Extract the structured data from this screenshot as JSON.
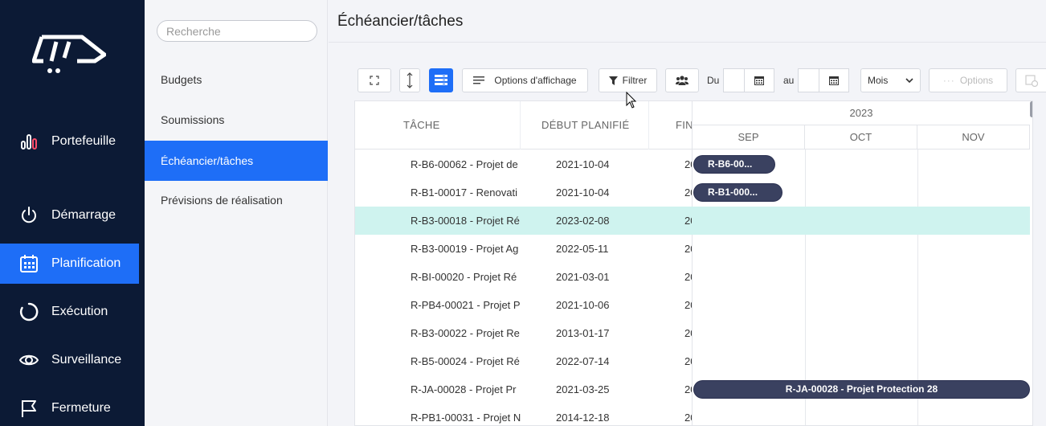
{
  "nav": {
    "items": [
      {
        "label": "Portefeuille",
        "icon": "chart-bars-icon"
      },
      {
        "label": "Démarrage",
        "icon": "power-icon"
      },
      {
        "label": "Planification",
        "icon": "calendar-icon",
        "active": true
      },
      {
        "label": "Exécution",
        "icon": "progress-circle-icon"
      },
      {
        "label": "Surveillance",
        "icon": "eye-icon"
      },
      {
        "label": "Fermeture",
        "icon": "flag-icon"
      }
    ]
  },
  "sidebar": {
    "search_placeholder": "Recherche",
    "items": [
      {
        "label": "Budgets"
      },
      {
        "label": "Soumissions"
      },
      {
        "label": "Échéancier/tâches",
        "active": true
      },
      {
        "label": "Prévisions de réalisation"
      }
    ]
  },
  "header": {
    "title": "Échéancier/tâches"
  },
  "toolbar": {
    "display_options_label": "Options d'affichage",
    "filter_label": "Filtrer",
    "from_label": "Du",
    "to_label": "au",
    "scale_select": "Mois",
    "options_label": "Options"
  },
  "grid": {
    "columns": [
      "TÂCHE",
      "DÉBUT PLANIFIÉ",
      "FIN"
    ],
    "year": "2023",
    "months": [
      "SEP",
      "OCT",
      "NOV"
    ],
    "rows": [
      {
        "task": "R-B6-00062 - Projet de",
        "start": "2021-10-04",
        "end": "20",
        "bar": "R-B6-00..."
      },
      {
        "task": "R-B1-00017 - Renovati",
        "start": "2021-10-04",
        "end": "20",
        "bar": "R-B1-000..."
      },
      {
        "task": "R-B3-00018 - Projet Ré",
        "start": "2023-02-08",
        "end": "20"
      },
      {
        "task": "R-B3-00019 - Projet Ag",
        "start": "2022-05-11",
        "end": "20"
      },
      {
        "task": "R-BI-00020 - Projet Ré",
        "start": "2021-03-01",
        "end": "20"
      },
      {
        "task": "R-PB4-00021 - Projet P",
        "start": "2021-10-06",
        "end": "20"
      },
      {
        "task": "R-B3-00022 - Projet Re",
        "start": "2013-01-17",
        "end": "20"
      },
      {
        "task": "R-B5-00024 - Projet Ré",
        "start": "2022-07-14",
        "end": "20"
      },
      {
        "task": "R-JA-00028 - Projet Pr",
        "start": "2021-03-25",
        "end": "20",
        "bar": "R-JA-00028 - Projet Protection 28"
      },
      {
        "task": "R-PB1-00031 - Projet N",
        "start": "2014-12-18",
        "end": "20"
      }
    ],
    "selected_row": 2
  },
  "colors": {
    "nav_bg": "#0c1a35",
    "accent": "#1e6ef7",
    "selected_row": "#cff3ef",
    "bar": "#3a4160"
  }
}
